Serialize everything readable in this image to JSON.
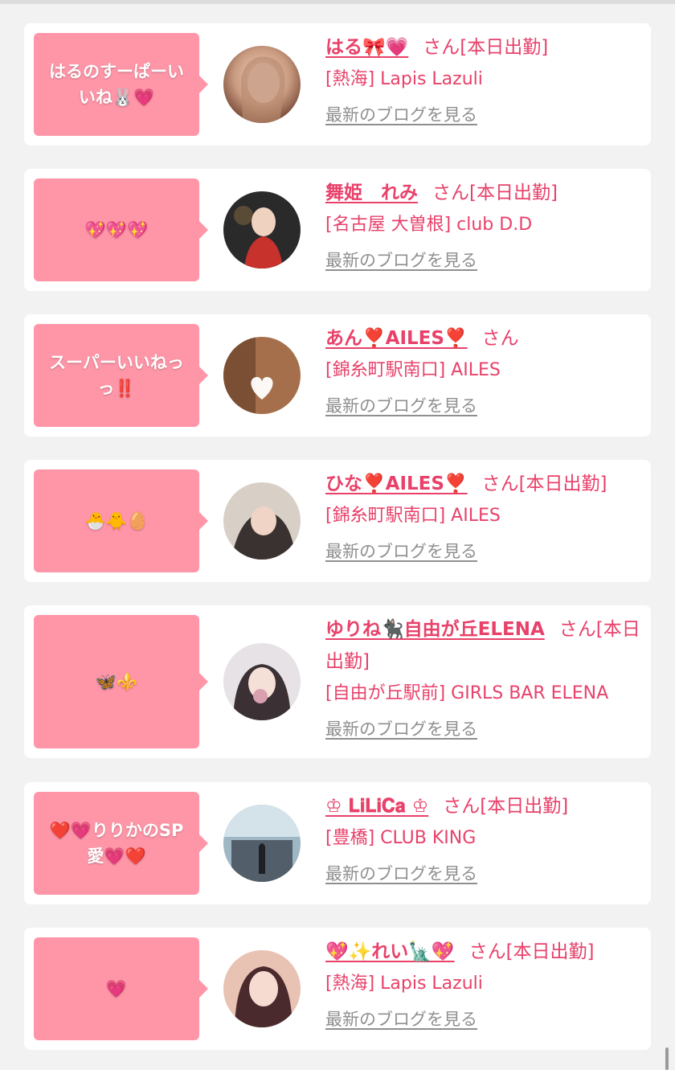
{
  "entries": [
    {
      "comment_lines": [
        "はるのすーぱーい",
        "いね🐰💗"
      ],
      "name": "はる🎀💗",
      "status": "さん[本日出勤]",
      "shop": "[熱海] Lapis Lazuli",
      "blog_link": "最新のブログを見る",
      "avatar_colors": [
        "#c99b80",
        "#7a4c3a"
      ]
    },
    {
      "comment_lines": [
        "💖💖💖"
      ],
      "name": "舞姫　れみ",
      "status": "さん[本日出勤]",
      "shop": "[名古屋 大曽根] club D.D",
      "blog_link": "最新のブログを見る",
      "avatar_colors": [
        "#2a2a2a",
        "#c8322d"
      ]
    },
    {
      "comment_lines": [
        "スーパーいいねっ",
        "っ‼️"
      ],
      "name": "あん❣️AILES❣️",
      "status": "さん",
      "shop": "[錦糸町駅南口] AILES",
      "blog_link": "最新のブログを見る",
      "avatar_colors": [
        "#c08a62",
        "#5e3a24"
      ]
    },
    {
      "comment_lines": [
        "🐣🐥🥚"
      ],
      "name": "ひな❣️AILES❣️",
      "status": "さん[本日出勤]",
      "shop": "[錦糸町駅南口] AILES",
      "blog_link": "最新のブログを見る",
      "avatar_colors": [
        "#d8cfc6",
        "#3a3230"
      ]
    },
    {
      "comment_lines": [
        "🦋⚜️"
      ],
      "name": "ゆりね🐈‍⬛自由が丘ELENA",
      "status": "さん[本日出勤]",
      "shop": "[自由が丘駅前] GIRLS BAR ELENA",
      "blog_link": "最新のブログを見る",
      "avatar_colors": [
        "#e6e2e6",
        "#3b3134"
      ]
    },
    {
      "comment_lines": [
        "❤️💗りりかのSP",
        "愛💗❤️"
      ],
      "name": "♔ 𝐋𝐢𝐋𝐢𝐂𝐚 ♔",
      "status": "さん[本日出勤]",
      "shop": "[豊橋] CLUB KING",
      "blog_link": "最新のブログを見る",
      "avatar_colors": [
        "#9fb6c4",
        "#3e4852"
      ]
    },
    {
      "comment_lines": [
        "💗"
      ],
      "name": "💖✨れい🗽💖",
      "status": "さん[本日出勤]",
      "shop": "[熱海] Lapis Lazuli",
      "blog_link": "最新のブログを見る",
      "avatar_colors": [
        "#e8c2b2",
        "#4a2a2c"
      ]
    }
  ]
}
